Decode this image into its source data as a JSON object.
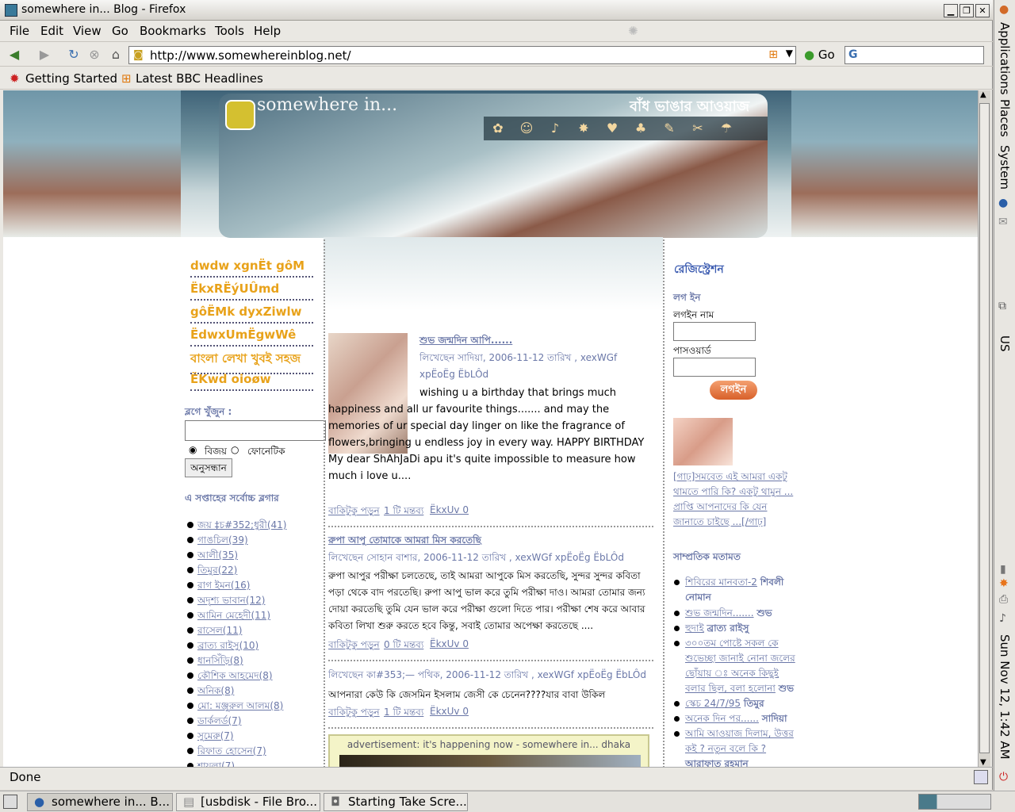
{
  "window": {
    "title": "somewhere in... Blog - Firefox",
    "menu": [
      "File",
      "Edit",
      "View",
      "Go",
      "Bookmarks",
      "Tools",
      "Help"
    ],
    "url": "http://www.somewhereinblog.net/",
    "go_label": "Go",
    "bookmarks": [
      "Getting Started",
      "Latest BBC Headlines"
    ],
    "status": "Done"
  },
  "taskbar": {
    "tasks": [
      "somewhere in... B...",
      "[usbdisk - File Bro...",
      "Starting Take Scre..."
    ]
  },
  "panel": {
    "menus": [
      "Applications",
      "Places",
      "System"
    ],
    "keyboard": "US",
    "clock": "Sun Nov 12,  1:42 AM"
  },
  "banner": {
    "site_name": "somewhere in...",
    "tagline": "বাঁধ ভাঙার আওয়াজ"
  },
  "left": {
    "links": [
      "dwdw xgnËt gôM",
      "ËkxRËýUÛmd",
      "gôËMk dyxZiwlw",
      "ËdwxUmËgwWê",
      "বাংলা লেখা খুবই সহজ",
      "ËKwd oioøw"
    ],
    "search_title": "ব্লগে খুঁজুন :",
    "radio_bijoy": "বিজয়",
    "radio_phonetic": "ফোনেটিক",
    "search_button": "অনুসন্ধান",
    "top_title": "এ সপ্তাহের সর্বোচ্চ ব্লগার",
    "top_bloggers": [
      "জয় ‡চ#352;ধুরী(41)",
      "গাঙচিল(39)",
      "আলী(35)",
      "তিমুর(22)",
      "রাগ ইমন(16)",
      "অদৃশ্য ভাবান(12)",
      "আমিন মেহেদী(11)",
      "রাসেল(11)",
      "ব্রাত্য রাইসু(10)",
      "ধানসিঁড়ি(8)",
      "কৌশিক আহমেদ(8)",
      "অনিক(8)",
      "মো: মঞ্জুরুল আলম(8)",
      "ডার্কলর্ড(7)",
      "সুমেরু(7)",
      "রিফাত হোসেন(7)",
      "শায়লা(7)"
    ]
  },
  "posts": [
    {
      "title": "শুভ জন্মদিন আপি......",
      "meta": "লিখেছেন সাদিয়া, 2006-11-12 তারিখ , xexWGf xpËoËg ËbLÔd",
      "body": "wishing u a birthday that brings much happiness and all ur favourite things....... and may the memories of ur special day linger on like the fragrance of flowers,bringing u endless joy in every way. HAPPY BIRTHDAY My dear ShAhJaDi apu it's quite impossible to measure how much i love u....",
      "more": "বাকিটুকু পড়ুন",
      "comments": "1 টি মন্তব্য",
      "extra": "ËkxUv 0"
    },
    {
      "title": "রুপা আপু তোমাকে আমরা মিস করতেছি",
      "meta": "লিখেছেন সোহান বাশার, 2006-11-12 তারিখ , xexWGf xpËoËg ËbLÔd",
      "body": "রুপা আপুর পরীক্ষা চলতেছে, তাই আমরা আপুকে মিস করতেছি, সুন্দর সুন্দর কবিতা পড়া থেকে বাদ পরতেছি। রুপা আপু ভাল করে তুমি পরীক্ষা দাও। আমরা তোমার জন্য দোয়া করতেছি তুমি যেন ভাল করে পরীক্ষা গুলো দিতে পার। পরীক্ষা শেষ করে আবার কবিতা লিখা শুরু করতে হবে কিন্তু, সবাই তোমার অপেক্ষা করতেছে ....",
      "more": "বাকিটুকু পড়ুন",
      "comments": "0 টি মন্তব্য",
      "extra": "ËkxUv 0"
    },
    {
      "meta": "লিখেছেন কা#353;— পথিক, 2006-11-12 তারিখ , xexWGf xpËoËg ËbLÔd",
      "body": "আপনারা কেউ কি জেসমিন ইসলাম জেসী কে চেনেন????যার বাবা উকিল",
      "more": "বাকিটুকু পড়ুন",
      "comments": "1 টি মন্তব্য",
      "extra": "ËkxUv 0"
    }
  ],
  "ad": "advertisement: it's happening now - somewhere in... dhaka",
  "right": {
    "register": "রেজিস্ট্রেশন",
    "login_title": "লগ ইন",
    "username_label": "লগইন নাম",
    "password_label": "পাসওয়ার্ড",
    "login_button": "লগইন",
    "photo_caption": "[গাঢ়]সমবেত এই আমরা একটু থামতে পারি কি? একটু থামুন ... প্রাপ্তি আপনাদের কি যেন জানাতে চাইছে ...[/গাঢ়]",
    "recent_title": "সাম্প্রতিক মতামত",
    "recent": [
      {
        "text": "শিবিরের মানবতা-2",
        "author": "শিবলী নোমান"
      },
      {
        "text": "শুভ জন্মদিন.......",
        "author": "শুভ"
      },
      {
        "text": "হুদাই",
        "author": "ব্রাত্য রাইসু"
      },
      {
        "text": "৩০০তম পোষ্টে সকল কে শুভেচ্ছা জানাই নোনা জলের ছোঁয়ায় ঃ অনেক কিছুই বলার ছিল, বলা হলোনা",
        "author": "শুভ"
      },
      {
        "text": "স্কেচ 24/7/95",
        "author": "তিমুর"
      },
      {
        "text": "অনেক দিন পর......",
        "author": "সাদিয়া"
      },
      {
        "text": "আমি আওয়াজ দিলাম, উত্তর কই ? নতুন বলে কি ?",
        "author": "আরাফাত রহমান"
      }
    ]
  }
}
